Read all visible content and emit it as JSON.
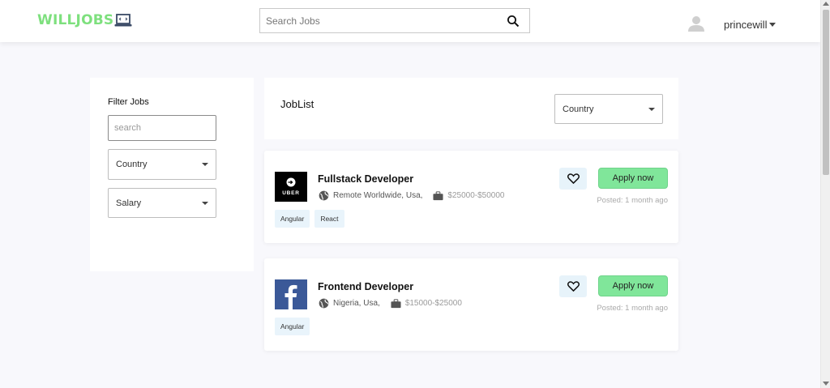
{
  "header": {
    "logo_text": "WILLJOBS",
    "search_placeholder": "Search Jobs",
    "username": "princewill"
  },
  "colors": {
    "brand_green": "#7ee07e",
    "apply_green": "#80e69a",
    "tag_bg": "#e9f4fb"
  },
  "filter": {
    "title": "Filter Jobs",
    "search_placeholder": "search",
    "country_label": "Country",
    "salary_label": "Salary"
  },
  "joblist": {
    "title": "JobList",
    "country_label": "Country"
  },
  "jobs": [
    {
      "company_logo": "uber-logo",
      "logo_text": "UBER",
      "title": "Fullstack Developer",
      "location": "Remote Worldwide, Usa,",
      "salary": "$25000-$50000",
      "tags": [
        "Angular",
        "React"
      ],
      "apply_label": "Apply now",
      "posted": "Posted: 1 month ago"
    },
    {
      "company_logo": "facebook-logo",
      "title": "Frontend Developer",
      "location": "Nigeria, Usa,",
      "salary": "$15000-$25000",
      "tags": [
        "Angular"
      ],
      "apply_label": "Apply now",
      "posted": "Posted: 1 month ago"
    }
  ]
}
